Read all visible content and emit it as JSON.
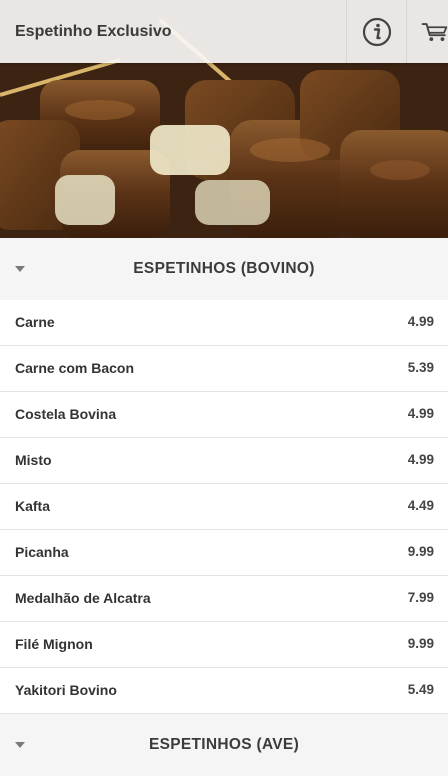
{
  "header": {
    "title": "Espetinho Exclusivo",
    "info_icon": "info-icon",
    "cart_icon": "cart-icon"
  },
  "sections": [
    {
      "title": "ESPETINHOS (BOVINO)",
      "items": [
        {
          "name": "Carne",
          "price": "4.99"
        },
        {
          "name": "Carne com Bacon",
          "price": "5.39"
        },
        {
          "name": "Costela Bovina",
          "price": "4.99"
        },
        {
          "name": "Misto",
          "price": "4.99"
        },
        {
          "name": "Kafta",
          "price": "4.49"
        },
        {
          "name": "Picanha",
          "price": "9.99"
        },
        {
          "name": "Medalhão de Alcatra",
          "price": "7.99"
        },
        {
          "name": "Filé Mignon",
          "price": "9.99"
        },
        {
          "name": "Yakitori Bovino",
          "price": "5.49"
        }
      ]
    },
    {
      "title": "ESPETINHOS (AVE)",
      "items": []
    }
  ]
}
